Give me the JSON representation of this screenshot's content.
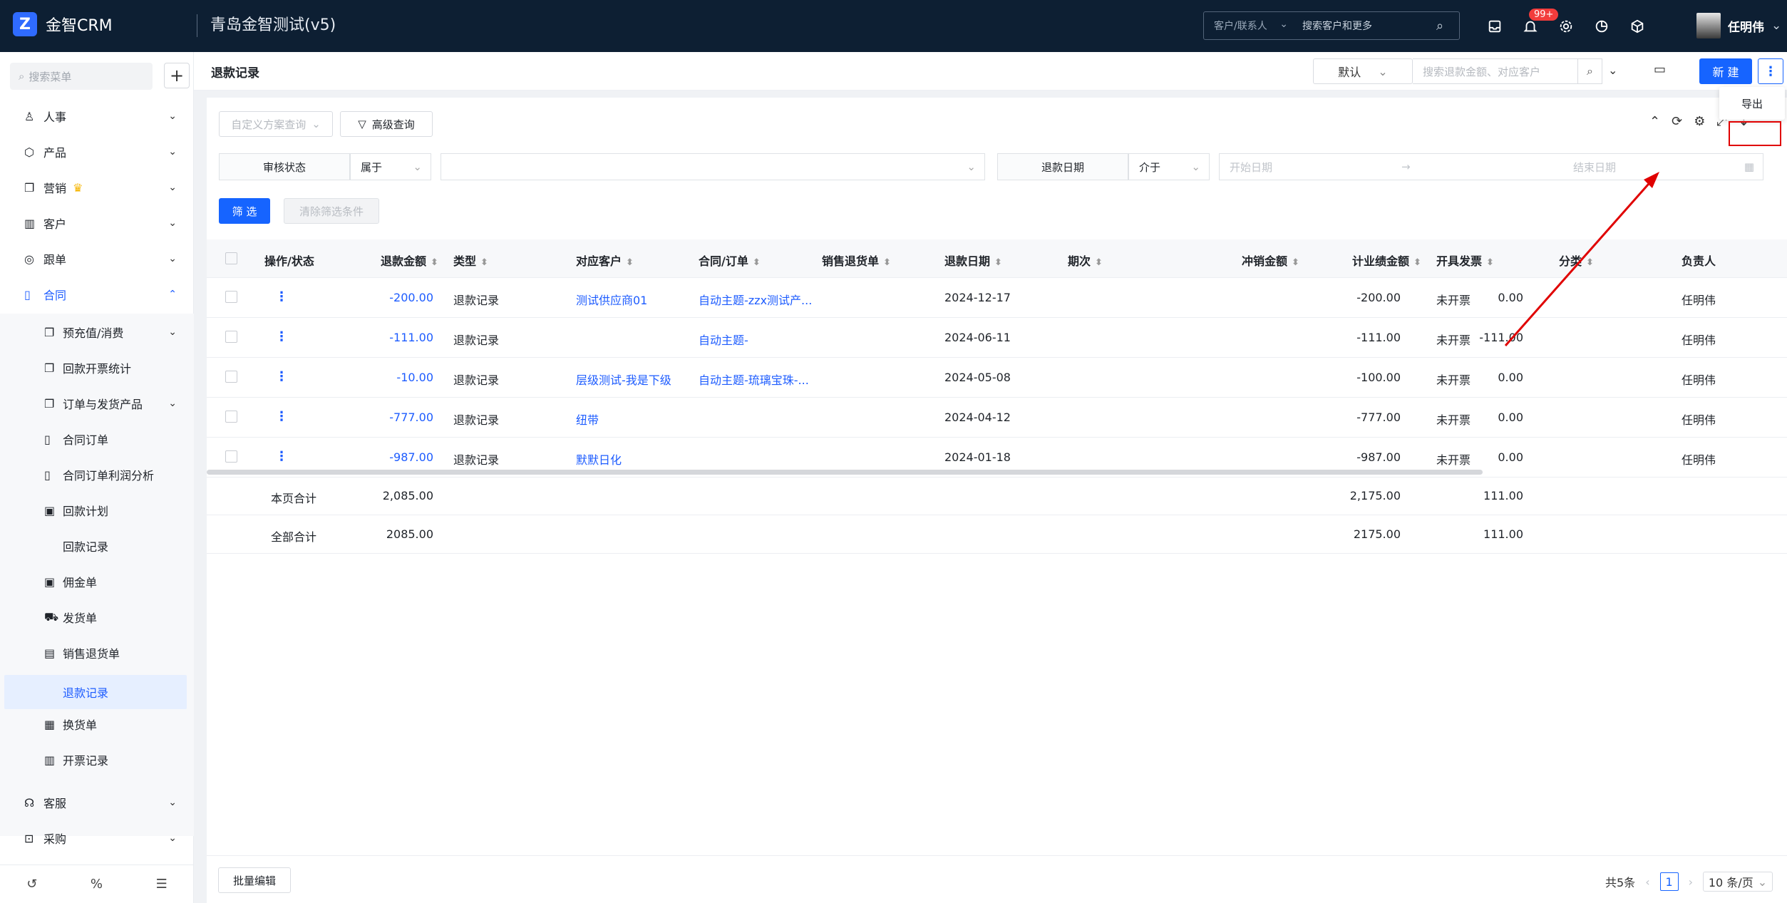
{
  "topbar": {
    "app_name": "金智CRM",
    "system_title": "青岛金智测试(v5)",
    "search_scope": "客户/联系人",
    "search_placeholder": "搜索客户和更多",
    "notification_count": "99+",
    "user_name": "任明伟"
  },
  "sidebar": {
    "search_placeholder": "搜索菜单",
    "items": [
      {
        "label": "人事"
      },
      {
        "label": "产品"
      },
      {
        "label": "营销"
      },
      {
        "label": "客户"
      },
      {
        "label": "跟单"
      },
      {
        "label": "合同"
      }
    ],
    "sub_items": [
      {
        "label": "预充值/消费"
      },
      {
        "label": "回款开票统计"
      },
      {
        "label": "订单与发货产品"
      },
      {
        "label": "合同订单"
      },
      {
        "label": "合同订单利润分析"
      },
      {
        "label": "回款计划"
      },
      {
        "label": "回款记录"
      },
      {
        "label": "佣金单"
      },
      {
        "label": "发货单"
      },
      {
        "label": "销售退货单"
      },
      {
        "label": "退款记录"
      },
      {
        "label": "换货单"
      },
      {
        "label": "开票记录"
      }
    ],
    "bottom_items": [
      {
        "label": "客服"
      },
      {
        "label": "采购"
      }
    ]
  },
  "page": {
    "title": "退款记录",
    "view_select": "默认",
    "search_placeholder": "搜索退款金额、对应客户",
    "new_button": "新 建",
    "export_label": "导出"
  },
  "query": {
    "custom_scheme": "自定义方案查询",
    "advanced": "高级查询",
    "f1_field": "审核状态",
    "f1_op": "属于",
    "f2_field": "退款日期",
    "f2_op": "介于",
    "start_date": "开始日期",
    "end_date": "结束日期",
    "filter_button": "筛 选",
    "clear_button": "清除筛选条件"
  },
  "table": {
    "headers": [
      "操作/状态",
      "退款金额",
      "类型",
      "对应客户",
      "合同/订单",
      "销售退货单",
      "退款日期",
      "期次",
      "冲销金额",
      "计业绩金额",
      "开具发票",
      "分类",
      "负责人"
    ],
    "rows": [
      {
        "amount": "-200.00",
        "type": "退款记录",
        "customer": "测试供应商01",
        "contract": "自动主题-zzx测试产...",
        "date": "2024-12-17",
        "offset": "-200.00",
        "perf": "0.00",
        "invoice": "未开票",
        "owner": "任明伟"
      },
      {
        "amount": "-111.00",
        "type": "退款记录",
        "customer": "",
        "contract": "自动主题-",
        "date": "2024-06-11",
        "offset": "-111.00",
        "perf": "-111.00",
        "invoice": "未开票",
        "owner": "任明伟"
      },
      {
        "amount": "-10.00",
        "type": "退款记录",
        "customer": "层级测试-我是下级",
        "contract": "自动主题-琉璃宝珠-...",
        "date": "2024-05-08",
        "offset": "-100.00",
        "perf": "0.00",
        "invoice": "未开票",
        "owner": "任明伟"
      },
      {
        "amount": "-777.00",
        "type": "退款记录",
        "customer": "纽带",
        "contract": "",
        "date": "2024-04-12",
        "offset": "-777.00",
        "perf": "0.00",
        "invoice": "未开票",
        "owner": "任明伟"
      },
      {
        "amount": "-987.00",
        "type": "退款记录",
        "customer": "默默日化",
        "contract": "",
        "date": "2024-01-18",
        "offset": "-987.00",
        "perf": "0.00",
        "invoice": "未开票",
        "owner": "任明伟"
      }
    ],
    "page_total": {
      "label": "本页合计",
      "amount": "2,085.00",
      "offset": "2,175.00",
      "perf": "111.00"
    },
    "all_total": {
      "label": "全部合计",
      "amount": "2085.00",
      "offset": "2175.00",
      "perf": "111.00"
    }
  },
  "footer": {
    "batch_edit": "批量编辑",
    "total_text": "共5条",
    "current_page": "1",
    "page_size": "10 条/页"
  },
  "colors": {
    "accent": "#1664ff",
    "annotation": "#e00000",
    "topbar": "#0d1f33"
  }
}
